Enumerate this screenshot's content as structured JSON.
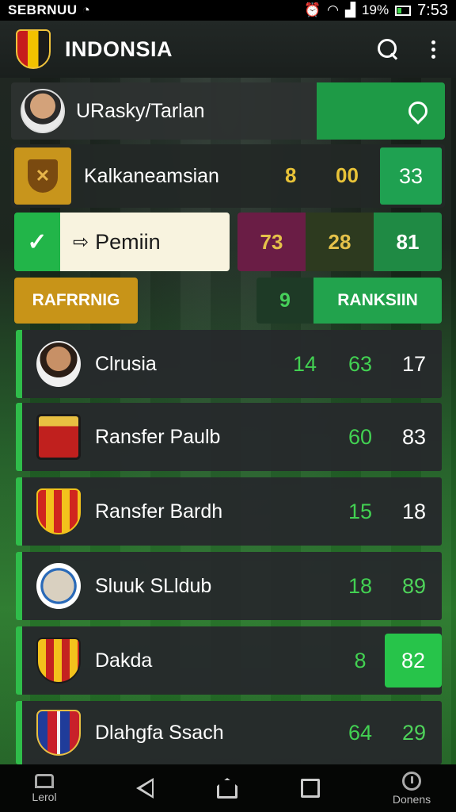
{
  "status_bar": {
    "carrier": "SEBRNUU",
    "battery": "19%",
    "time": "7:53"
  },
  "app_bar": {
    "title": "INDONSIA"
  },
  "user": {
    "name": "URasky/Tarlan"
  },
  "competition": {
    "name": "Kalkaneamsian",
    "v1": "8",
    "v2": "00",
    "v3": "33"
  },
  "player": {
    "label": "Pemiin",
    "v1": "73",
    "v2": "28",
    "v3": "81"
  },
  "ranking": {
    "left_label": "RAFRRNIG",
    "number": "9",
    "right_label": "RANKSIIN"
  },
  "list": [
    {
      "name": "Clrusia",
      "a": "14",
      "b": "63",
      "c": "17"
    },
    {
      "name": "Ransfer Paulb",
      "b": "60",
      "c": "83"
    },
    {
      "name": "Ransfer Bardh",
      "b": "15",
      "c": "18"
    },
    {
      "name": "Sluuk SLldub",
      "b": "18",
      "c": "89"
    },
    {
      "name": "Dakda",
      "b": "8",
      "c": "82"
    },
    {
      "name": "Dlahgfa Ssach",
      "b": "64",
      "c": "29"
    }
  ],
  "nav": {
    "left_label": "Lerol",
    "right_label": "Donens"
  },
  "colors": {
    "accent_green": "#22b549",
    "gold": "#c89418",
    "panel": "#262a2c"
  }
}
